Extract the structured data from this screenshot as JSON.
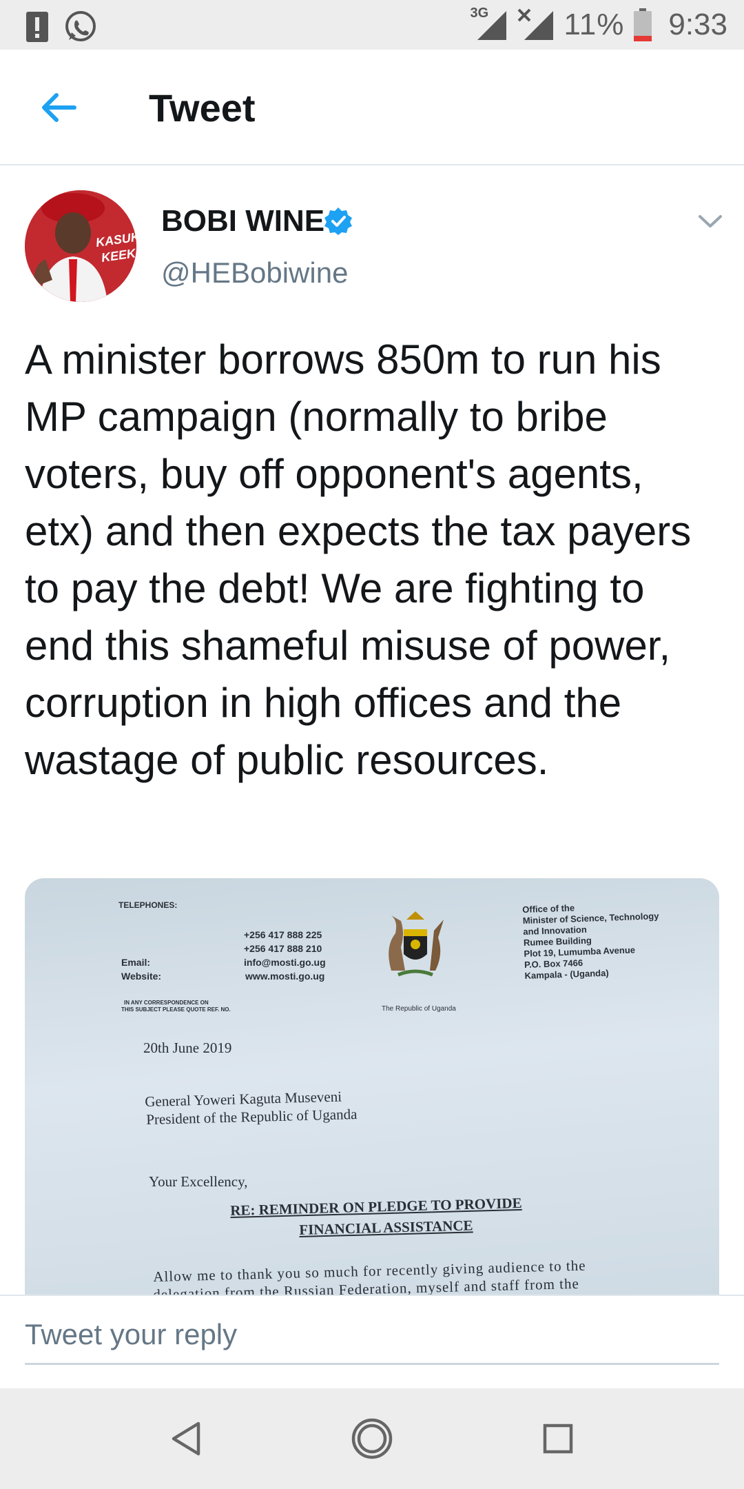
{
  "status_bar": {
    "network_type": "3G",
    "battery_percent": "11%",
    "time": "9:33"
  },
  "app_bar": {
    "title": "Tweet"
  },
  "tweet": {
    "author_name": "BOBI WINE",
    "handle": "@HEBobiwine",
    "avatar_text": [
      "KASUKA",
      "KEEKO?"
    ],
    "text": "A minister borrows 850m to run his MP campaign (normally to bribe voters, buy off opponent's agents, etx) and then expects the tax payers to pay the debt! We are fighting to end this shameful misuse of power, corruption in high offices and the wastage of public resources."
  },
  "media": {
    "letter": {
      "telephones_label": "TELEPHONES:",
      "phone_1": "+256 417 888 225",
      "phone_2": "+256 417 888 210",
      "email_label": "Email:",
      "email": "info@mosti.go.ug",
      "website_label": "Website:",
      "website": "www.mosti.go.ug",
      "correspondence_note_1": "IN ANY CORRESPONDENCE ON",
      "correspondence_note_2": "THIS SUBJECT PLEASE QUOTE REF. NO.",
      "coat_of_arms_caption": "The Republic of Uganda",
      "office_lines": [
        "Office of the",
        "Minister of Science, Technology",
        "and Innovation",
        "Rumee Building",
        "Plot 19, Lumumba Avenue",
        "P.O. Box 7466",
        "Kampala - (Uganda)"
      ],
      "date": "20th June 2019",
      "recipient_1": "General Yoweri Kaguta Museveni",
      "recipient_2": "President of the Republic of Uganda",
      "salutation": "Your Excellency,",
      "subject_1": "RE: REMINDER ON PLEDGE TO PROVIDE",
      "subject_2": "FINANCIAL ASSISTANCE",
      "body_1": "Allow me to thank you so much for recently giving audience to the",
      "body_2": "delegation from the Russian Federation, myself and staff from the"
    }
  },
  "reply": {
    "placeholder": "Tweet your reply"
  },
  "colors": {
    "accent": "#1da1f2",
    "text_primary": "#14171a",
    "text_secondary": "#657786"
  }
}
